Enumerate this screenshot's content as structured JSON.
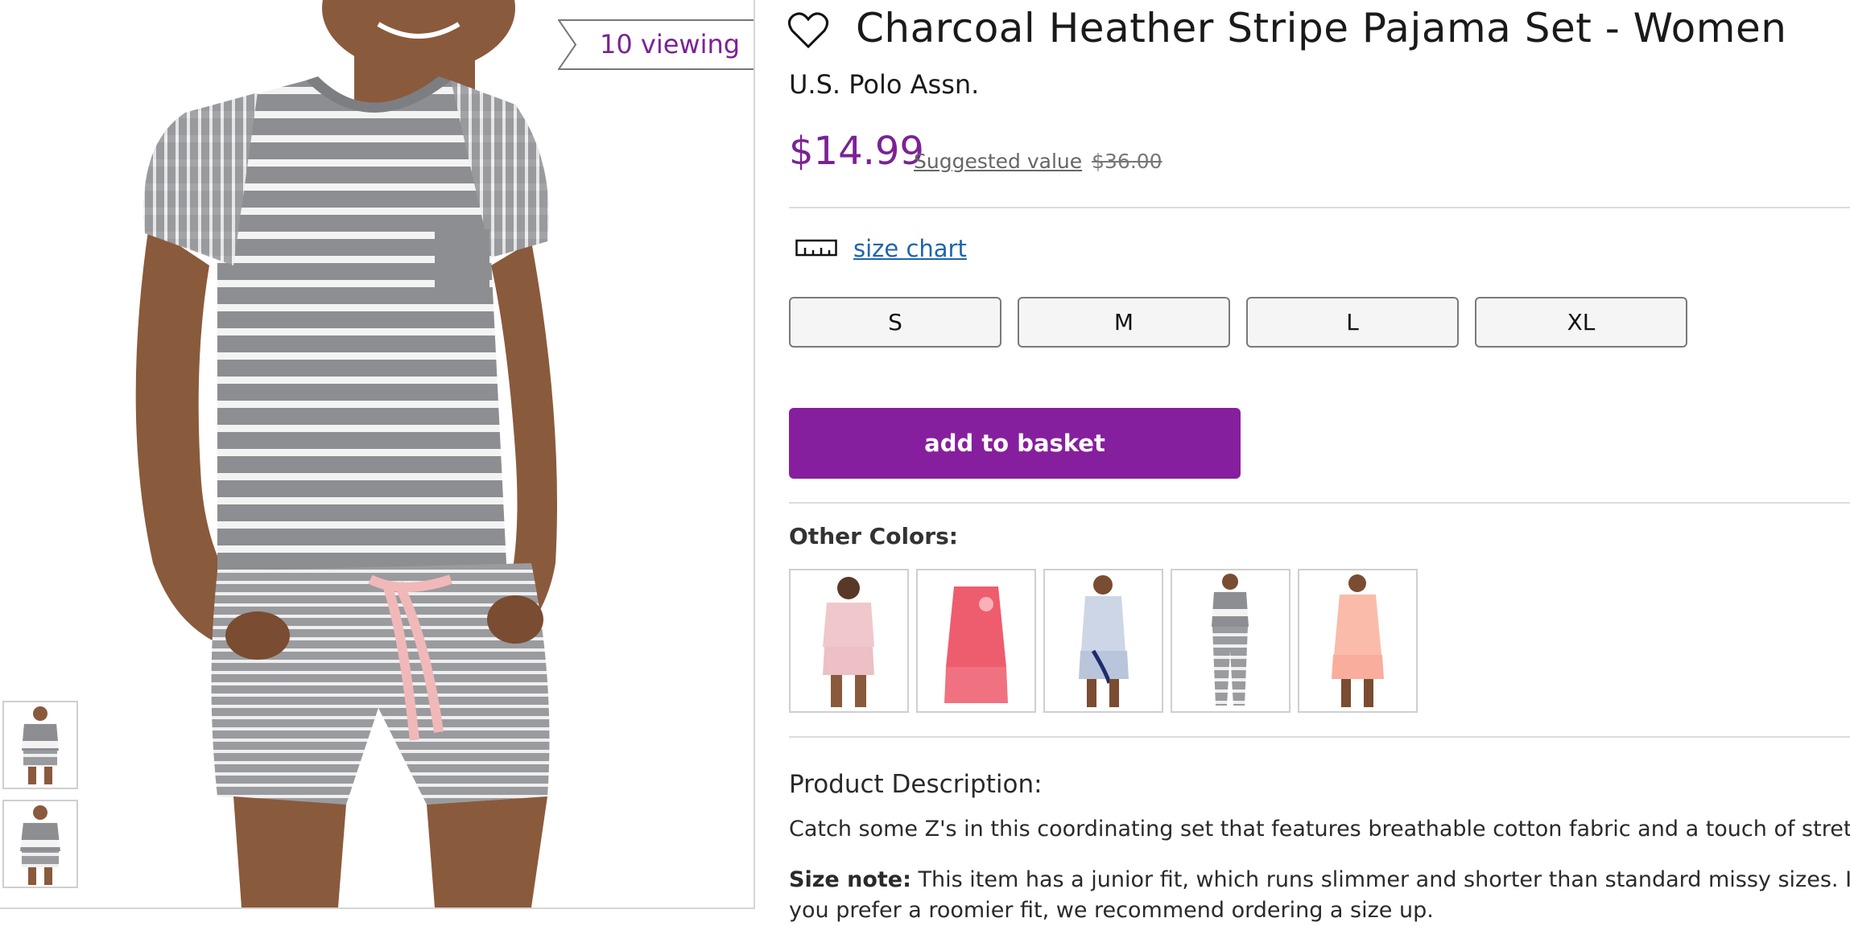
{
  "product": {
    "viewing_badge": "10 viewing",
    "title": "Charcoal Heather Stripe Pajama Set - Women",
    "brand": "U.S. Polo Assn.",
    "price": "$14.99",
    "suggested_label": "Suggested value",
    "suggested_price": "$36.00"
  },
  "size_chart": {
    "label": "size chart",
    "icon": "ruler-icon"
  },
  "sizes": [
    "S",
    "M",
    "L",
    "XL"
  ],
  "basket_button": "add to basket",
  "other_colors": {
    "label": "Other Colors:",
    "swatches": [
      "pink-stripe",
      "coral-stripe-tank",
      "light-blue-tank",
      "charcoal-pant",
      "peach-solid"
    ]
  },
  "description": {
    "heading": "Product Description:",
    "text": "Catch some Z's in this coordinating set that features breathable cotton fabric and a touch of stretch",
    "size_note_label": "Size note:",
    "size_note_text": "This item has a junior fit, which runs slimmer and shorter than standard missy sizes. If you prefer a roomier fit, we recommend ordering a size up."
  },
  "colors": {
    "accent": "#7b2295",
    "button": "#861f9d",
    "link": "#1f64b0"
  },
  "icons": {
    "favorite": "heart-outline-icon"
  }
}
